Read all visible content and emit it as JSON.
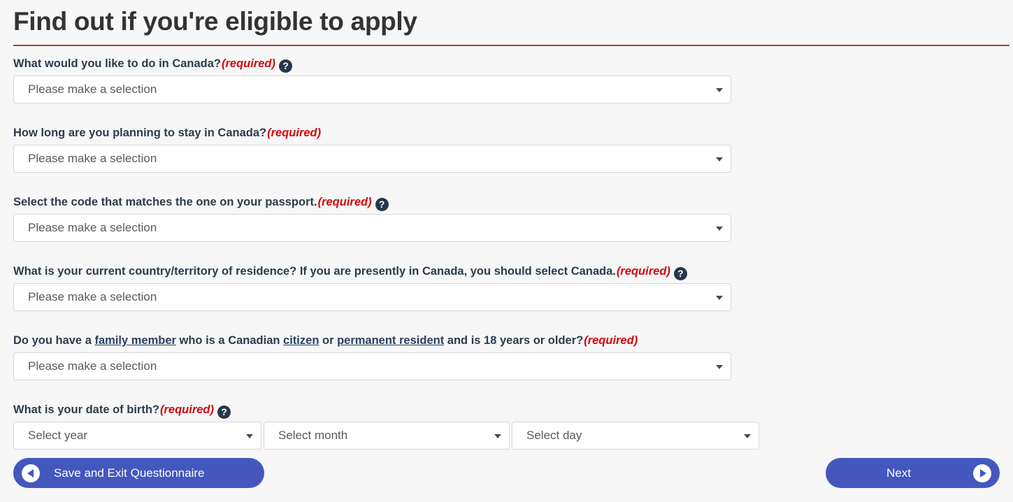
{
  "page": {
    "title": "Find out if you're eligible to apply",
    "accent_rule_color": "#af3c43",
    "background_color": "#f7f7f8",
    "required_text_color": "#d3080c",
    "link_color": "#284162",
    "button_color": "#4457bd",
    "help_icon_color": "#26374a"
  },
  "common": {
    "required_marker": "(required)",
    "help_icon_glyph": "?",
    "help_icon_name": "question-mark-icon",
    "placeholder_selection": "Please make a selection"
  },
  "questions": [
    {
      "id": "purpose",
      "label": "What would you like to do in Canada?",
      "required": "(required)",
      "has_help": true,
      "value": "Please make a selection"
    },
    {
      "id": "duration",
      "label": "How long are you planning to stay in Canada?",
      "required": "(required)",
      "has_help": false,
      "value": "Please make a selection"
    },
    {
      "id": "passport-code",
      "label": "Select the code that matches the one on your passport.",
      "required": "(required)",
      "has_help": true,
      "value": "Please make a selection"
    },
    {
      "id": "country-of-residence",
      "label": "What is your current country/territory of residence? If you are presently in Canada, you should select Canada.",
      "required": "(required)",
      "has_help": true,
      "value": "Please make a selection"
    },
    {
      "id": "family-member",
      "label_parts": {
        "p1": "Do you have a ",
        "link1": "family member",
        "p2": " who is a Canadian ",
        "link2": "citizen",
        "p3": " or ",
        "link3": "permanent resident",
        "p4": " and is 18 years or older?"
      },
      "required": "(required)",
      "has_help": false,
      "value": "Please make a selection"
    },
    {
      "id": "date-of-birth",
      "label": "What is your date of birth?",
      "required": "(required)",
      "has_help": true,
      "year_value": "Select year",
      "month_value": "Select month",
      "day_value": "Select day"
    }
  ],
  "footer": {
    "save_label": "Save and Exit Questionnaire",
    "next_label": "Next",
    "back_arrow_icon": "arrow-left-circle-icon",
    "forward_arrow_icon": "arrow-right-circle-icon"
  }
}
